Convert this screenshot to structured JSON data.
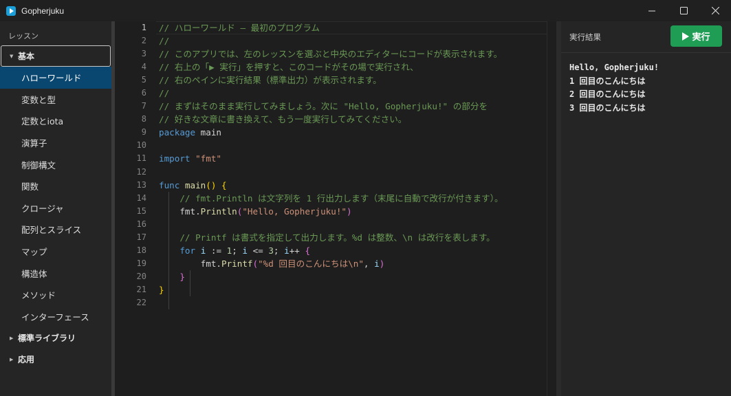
{
  "app": {
    "title": "Gopherjuku"
  },
  "window_controls": {
    "minimize": "minimize-icon",
    "maximize": "maximize-icon",
    "close": "close-icon"
  },
  "sidebar": {
    "heading": "レッスン",
    "categories": [
      {
        "label": "基本",
        "expanded": true,
        "lessons": [
          "ハローワールド",
          "変数と型",
          "定数とiota",
          "演算子",
          "制御構文",
          "関数",
          "クロージャ",
          "配列とスライス",
          "マップ",
          "構造体",
          "メソッド",
          "インターフェース"
        ],
        "selected_index": 0
      },
      {
        "label": "標準ライブラリ",
        "expanded": false
      },
      {
        "label": "応用",
        "expanded": false
      }
    ]
  },
  "editor": {
    "active_line": 1,
    "line_count": 22,
    "lines": [
      [
        {
          "t": "// ハローワールド — 最初のプログラム",
          "c": "comment"
        }
      ],
      [
        {
          "t": "//",
          "c": "comment"
        }
      ],
      [
        {
          "t": "// このアプリでは、左のレッスンを選ぶと中央のエディターにコードが表示されます。",
          "c": "comment"
        }
      ],
      [
        {
          "t": "// 右上の「▶ 実行」を押すと、このコードがその場で実行され、",
          "c": "comment"
        }
      ],
      [
        {
          "t": "// 右のペインに実行結果（標準出力）が表示されます。",
          "c": "comment"
        }
      ],
      [
        {
          "t": "//",
          "c": "comment"
        }
      ],
      [
        {
          "t": "// まずはそのまま実行してみましょう。次に \"Hello, Gopherjuku!\" の部分を",
          "c": "comment"
        }
      ],
      [
        {
          "t": "// 好きな文章に書き換えて、もう一度実行してみてください。",
          "c": "comment"
        }
      ],
      [
        {
          "t": "package",
          "c": "kw"
        },
        {
          "t": " main",
          "c": "id"
        }
      ],
      [],
      [
        {
          "t": "import",
          "c": "kw"
        },
        {
          "t": " ",
          "c": "id"
        },
        {
          "t": "\"fmt\"",
          "c": "str"
        }
      ],
      [],
      [
        {
          "t": "func",
          "c": "kw"
        },
        {
          "t": " ",
          "c": "id"
        },
        {
          "t": "main",
          "c": "fn"
        },
        {
          "t": "() ",
          "c": "brace"
        },
        {
          "t": "{",
          "c": "brace"
        }
      ],
      [
        {
          "t": "    // fmt.Println は文字列を 1 行出力します（末尾に自動で改行が付きます）。",
          "c": "comment"
        }
      ],
      [
        {
          "t": "    fmt.",
          "c": "id"
        },
        {
          "t": "Println",
          "c": "fn"
        },
        {
          "t": "(",
          "c": "paren"
        },
        {
          "t": "\"Hello, Gopherjuku!\"",
          "c": "str"
        },
        {
          "t": ")",
          "c": "paren"
        }
      ],
      [],
      [
        {
          "t": "    // Printf は書式を指定して出力します。%d は整数、\\n は改行を表します。",
          "c": "comment"
        }
      ],
      [
        {
          "t": "    ",
          "c": "id"
        },
        {
          "t": "for",
          "c": "ctrl"
        },
        {
          "t": " ",
          "c": "id"
        },
        {
          "t": "i",
          "c": "var"
        },
        {
          "t": " := ",
          "c": "id"
        },
        {
          "t": "1",
          "c": "num"
        },
        {
          "t": "; ",
          "c": "id"
        },
        {
          "t": "i",
          "c": "var"
        },
        {
          "t": " <= ",
          "c": "id"
        },
        {
          "t": "3",
          "c": "num"
        },
        {
          "t": "; ",
          "c": "id"
        },
        {
          "t": "i",
          "c": "var"
        },
        {
          "t": "++ ",
          "c": "id"
        },
        {
          "t": "{",
          "c": "paren"
        }
      ],
      [
        {
          "t": "        fmt.",
          "c": "id"
        },
        {
          "t": "Printf",
          "c": "fn"
        },
        {
          "t": "(",
          "c": "paren"
        },
        {
          "t": "\"%d 回目のこんにちは\\n\"",
          "c": "str"
        },
        {
          "t": ", ",
          "c": "id"
        },
        {
          "t": "i",
          "c": "var"
        },
        {
          "t": ")",
          "c": "paren"
        }
      ],
      [
        {
          "t": "    ",
          "c": "id"
        },
        {
          "t": "}",
          "c": "paren"
        }
      ],
      [
        {
          "t": "}",
          "c": "brace"
        }
      ],
      []
    ]
  },
  "output": {
    "title": "実行結果",
    "run_label": "実行",
    "lines": [
      "Hello, Gopherjuku!",
      "1 回目のこんにちは",
      "2 回目のこんにちは",
      "3 回目のこんにちは"
    ]
  },
  "colors": {
    "accent_run": "#1f9d55",
    "selection": "#094771",
    "comment": "#6a9955",
    "keyword": "#569cd6",
    "string": "#ce9178"
  }
}
